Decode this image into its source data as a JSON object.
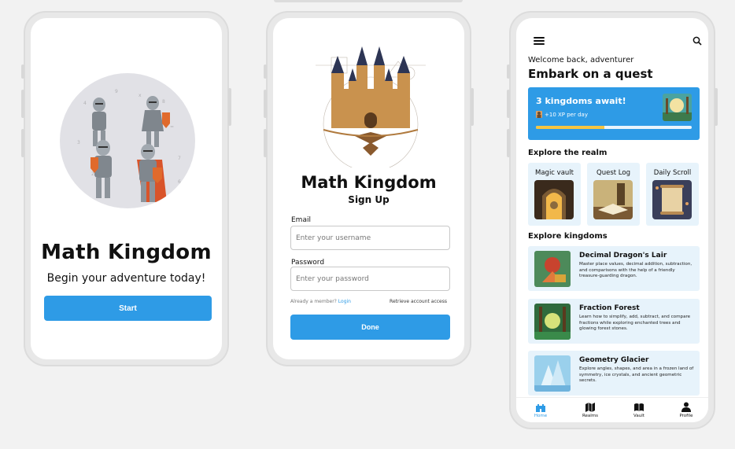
{
  "onboarding": {
    "title": "Math Kingdom",
    "subtitle": "Begin your adventure today!",
    "start_label": "Start"
  },
  "signup": {
    "title": "Math Kingdom",
    "subtitle": "Sign Up",
    "email_label": "Email",
    "email_placeholder": "Enter your username",
    "password_label": "Password",
    "password_placeholder": "Enter your password",
    "member_text": "Already a member?",
    "login_link": "Login",
    "retrieve_link": "Retrieve account access",
    "done_label": "Done"
  },
  "home": {
    "welcome": "Welcome back, adventurer",
    "headline": "Embark on a quest",
    "promo": {
      "title": "3 kingdoms await!",
      "xp": "+10 XP per day",
      "progress": 0.44
    },
    "explore_realm_title": "Explore the realm",
    "realm_cards": [
      {
        "label": "Magic vault"
      },
      {
        "label": "Quest Log"
      },
      {
        "label": "Daily Scroll"
      }
    ],
    "explore_kingdoms_title": "Explore kingdoms",
    "kingdoms": [
      {
        "name": "Decimal Dragon's Lair",
        "desc": "Master place values, decimal addition, subtraction, and comparisons with the help of a friendly treasure-guarding dragon."
      },
      {
        "name": "Fraction Forest",
        "desc": "Learn how to simplify, add, subtract, and compare fractions while exploring enchanted trees and glowing forest stones."
      },
      {
        "name": "Geometry Glacier",
        "desc": "Explore angles, shapes, and area in a frozen land of symmetry, ice crystals, and ancient geometric secrets."
      }
    ],
    "nav": [
      {
        "label": "Home"
      },
      {
        "label": "Realms"
      },
      {
        "label": "Vault"
      },
      {
        "label": "Profile"
      }
    ]
  }
}
